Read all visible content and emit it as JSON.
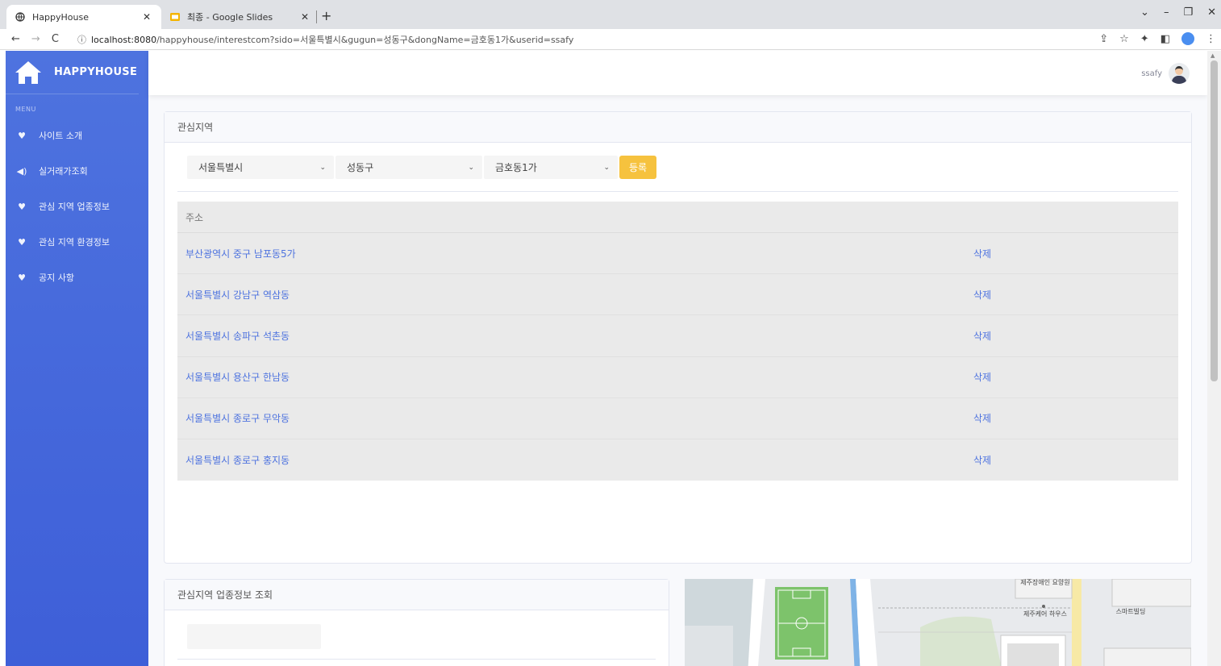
{
  "browser": {
    "tabs": [
      {
        "title": "HappyHouse",
        "icon": "globe-icon",
        "active": true
      },
      {
        "title": "최종 - Google Slides",
        "icon": "slides-icon",
        "active": false
      }
    ],
    "new_tab": "+",
    "url_host": "localhost:8080",
    "url_path": "/happyhouse/interestcom?sido=서울특별시&gugun=성동구&dongName=금호동1가&userid=ssafy"
  },
  "sidebar": {
    "brand": "HAPPYHOUSE",
    "menu_heading": "MENU",
    "items": [
      {
        "label": "사이트 소개",
        "icon": "heart-icon"
      },
      {
        "label": "실거래가조회",
        "icon": "volume-icon"
      },
      {
        "label": "관심 지역 업종정보",
        "icon": "heart-icon"
      },
      {
        "label": "관심 지역 환경정보",
        "icon": "heart-icon"
      },
      {
        "label": "공지 사항",
        "icon": "heart-icon"
      }
    ]
  },
  "topbar": {
    "username": "ssafy"
  },
  "interest": {
    "header": "관심지역",
    "sido": "서울특별시",
    "gugun": "성동구",
    "dong": "금호동1가",
    "register_label": "등록",
    "table_header": "주소",
    "rows": [
      {
        "address": "부산광역시 중구 남포동5가",
        "action": "삭제"
      },
      {
        "address": "서울특별시 강남구 역삼동",
        "action": "삭제"
      },
      {
        "address": "서울특별시 송파구 석촌동",
        "action": "삭제"
      },
      {
        "address": "서울특별시 용산구 한남동",
        "action": "삭제"
      },
      {
        "address": "서울특별시 종로구 무악동",
        "action": "삭제"
      },
      {
        "address": "서울특별시 종로구 홍지동",
        "action": "삭제"
      }
    ]
  },
  "business": {
    "header": "관심지역 업종정보 조회"
  },
  "map": {
    "labels": [
      "제주장애인 요양원",
      "제주케어 하우스",
      "스마트빌딩"
    ]
  },
  "colors": {
    "sidebar": "#4e73df",
    "link": "#4e73df",
    "register_button": "#f6c23e"
  }
}
